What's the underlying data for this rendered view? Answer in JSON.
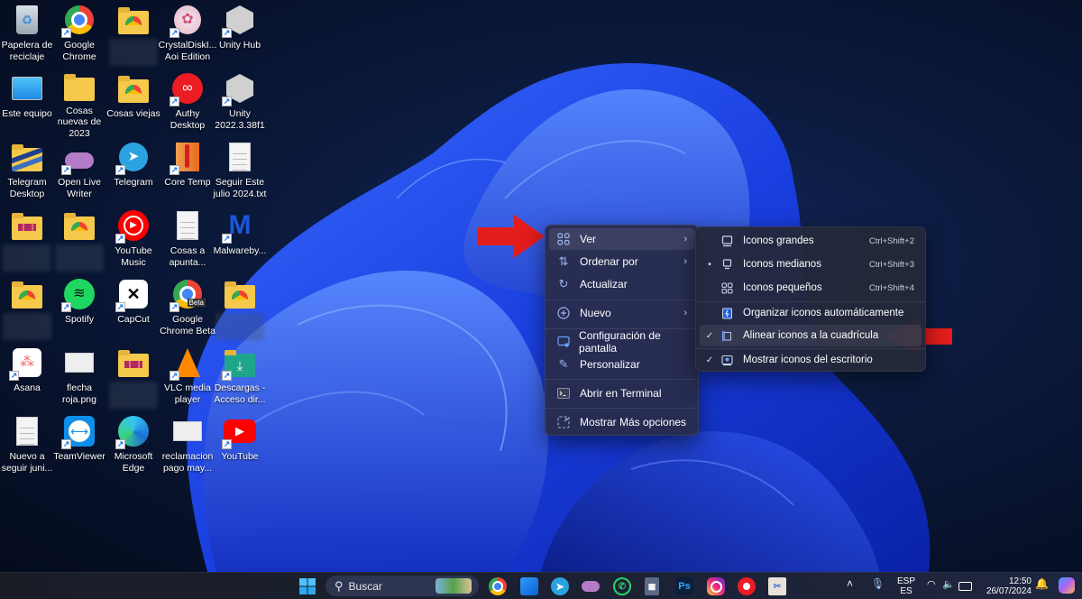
{
  "desktop": {
    "icons": [
      {
        "label": "Papelera de reciclaje",
        "icon": "recycle-bin-icon",
        "shortcut": false
      },
      {
        "label": "Google Chrome",
        "icon": "chrome-icon",
        "shortcut": true
      },
      {
        "label": "",
        "icon": "folder-chrome-icon",
        "shortcut": false,
        "blurred": true
      },
      {
        "label": "CrystalDiskI... Aoi Edition",
        "icon": "crystaldiskinfo-icon",
        "shortcut": true
      },
      {
        "label": "Unity Hub",
        "icon": "unity-hub-icon",
        "shortcut": true
      },
      {
        "label": "Este equipo",
        "icon": "computer-icon",
        "shortcut": false
      },
      {
        "label": "Cosas nuevas de 2023",
        "icon": "folder-icon",
        "shortcut": false
      },
      {
        "label": "Cosas viejas",
        "icon": "folder-chrome-icon",
        "shortcut": false
      },
      {
        "label": "Authy Desktop",
        "icon": "authy-icon",
        "shortcut": true
      },
      {
        "label": "Unity 2022.3.38f1",
        "icon": "unity-icon",
        "shortcut": true
      },
      {
        "label": "Telegram Desktop",
        "icon": "folder-striped-icon",
        "shortcut": false
      },
      {
        "label": "Open Live Writer",
        "icon": "open-live-writer-icon",
        "shortcut": true
      },
      {
        "label": "Telegram",
        "icon": "telegram-icon",
        "shortcut": true
      },
      {
        "label": "Core Temp",
        "icon": "core-temp-icon",
        "shortcut": true
      },
      {
        "label": "Seguir Este julio 2024.txt",
        "icon": "text-file-icon",
        "shortcut": false
      },
      {
        "label": "",
        "icon": "folder-boxes-icon",
        "shortcut": false,
        "blurred": true
      },
      {
        "label": "",
        "icon": "folder-chrome-icon",
        "shortcut": false,
        "blurred": true
      },
      {
        "label": "YouTube Music",
        "icon": "youtube-music-icon",
        "shortcut": true
      },
      {
        "label": "Cosas a apunta...",
        "icon": "text-file-icon",
        "shortcut": false
      },
      {
        "label": "Malwareby...",
        "icon": "malwarebytes-icon",
        "shortcut": true
      },
      {
        "label": "",
        "icon": "folder-chrome-icon",
        "shortcut": false,
        "blurred": true
      },
      {
        "label": "Spotify",
        "icon": "spotify-icon",
        "shortcut": true
      },
      {
        "label": "CapCut",
        "icon": "capcut-icon",
        "shortcut": true
      },
      {
        "label": "Google Chrome Beta",
        "icon": "chrome-beta-icon",
        "shortcut": true
      },
      {
        "label": "",
        "icon": "folder-chrome-icon",
        "shortcut": false,
        "blurred": true
      },
      {
        "label": "Asana",
        "icon": "asana-icon",
        "shortcut": true
      },
      {
        "label": "flecha roja.png",
        "icon": "image-file-icon",
        "shortcut": false
      },
      {
        "label": "",
        "icon": "folder-boxes-icon",
        "shortcut": false,
        "blurred": true
      },
      {
        "label": "VLC media player",
        "icon": "vlc-icon",
        "shortcut": true
      },
      {
        "label": "Descargas - Acceso dir...",
        "icon": "downloads-folder-icon",
        "shortcut": true
      },
      {
        "label": "Nuevo a seguir juni...",
        "icon": "text-file-icon",
        "shortcut": false
      },
      {
        "label": "TeamViewer",
        "icon": "teamviewer-icon",
        "shortcut": true
      },
      {
        "label": "Microsoft Edge",
        "icon": "edge-icon",
        "shortcut": true
      },
      {
        "label": "reclamacion pago may...",
        "icon": "image-file-icon",
        "shortcut": false
      },
      {
        "label": "YouTube",
        "icon": "youtube-icon",
        "shortcut": true
      }
    ]
  },
  "context_menu": {
    "items": [
      {
        "label": "Ver",
        "icon": "grid-icon",
        "submenu": true,
        "highlighted": true
      },
      {
        "label": "Ordenar por",
        "icon": "sort-icon",
        "submenu": true
      },
      {
        "label": "Actualizar",
        "icon": "refresh-icon",
        "submenu": false
      },
      {
        "label": "Nuevo",
        "icon": "plus-circle-icon",
        "submenu": true
      },
      {
        "label": "Configuración de pantalla",
        "icon": "display-settings-icon",
        "submenu": false
      },
      {
        "label": "Personalizar",
        "icon": "pen-icon",
        "submenu": false
      },
      {
        "label": "Abrir en Terminal",
        "icon": "terminal-icon",
        "submenu": false
      },
      {
        "label": "Mostrar Más opciones",
        "icon": "more-options-icon",
        "submenu": false
      }
    ],
    "submenu_arrow": "›"
  },
  "view_submenu": {
    "items": [
      {
        "label": "Iconos grandes",
        "shortcut": "Ctrl+Shift+2",
        "mark": "",
        "icon": "monitor-large-icon"
      },
      {
        "label": "Iconos medianos",
        "shortcut": "Ctrl+Shift+3",
        "mark": "•",
        "icon": "monitor-medium-icon"
      },
      {
        "label": "Iconos pequeños",
        "shortcut": "Ctrl+Shift+4",
        "mark": "",
        "icon": "small-grid-icon"
      },
      {
        "label": "Organizar iconos automáticamente",
        "shortcut": "",
        "mark": "",
        "icon": "auto-arrange-icon"
      },
      {
        "label": "Alinear iconos a la cuadrícula",
        "shortcut": "",
        "mark": "✓",
        "icon": "align-grid-icon",
        "highlighted": true
      },
      {
        "label": "Mostrar iconos del escritorio",
        "shortcut": "",
        "mark": "✓",
        "icon": "show-desktop-icon"
      }
    ]
  },
  "annotations": {
    "arrow_color": "#e31c1c"
  },
  "taskbar": {
    "search_placeholder": "Buscar",
    "apps": [
      "chrome",
      "widgets",
      "telegram",
      "open-live-writer",
      "whatsapp",
      "calculator",
      "photoshop",
      "instagram",
      "authy",
      "snipping-tool"
    ],
    "photoshop_label": "Ps",
    "language_line1": "ESP",
    "language_line2": "ES",
    "time": "12:50",
    "date": "26/07/2024"
  },
  "colors": {
    "menu_bg": "#282c4a",
    "submenu_bg": "#24283a",
    "accent": "#0067c0"
  }
}
